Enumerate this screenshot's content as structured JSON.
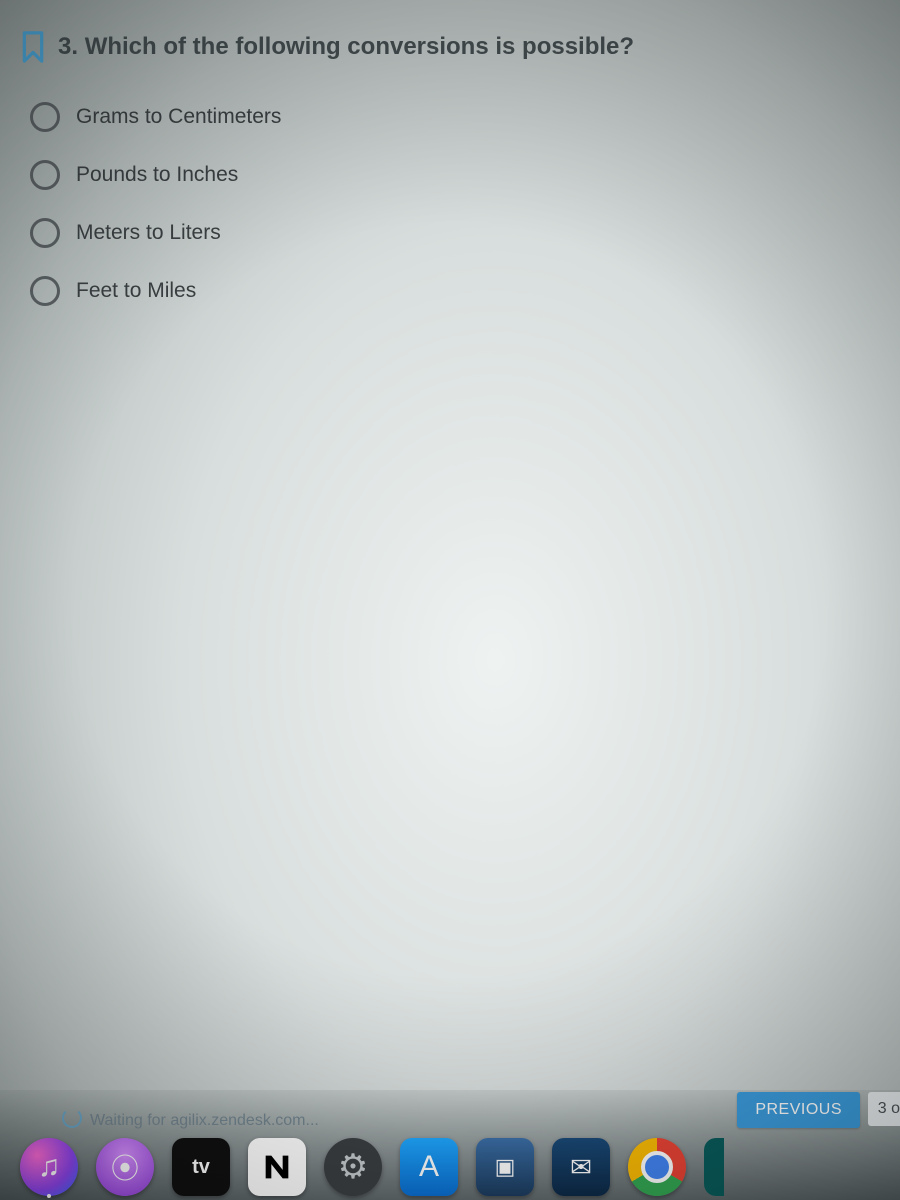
{
  "question": {
    "number": "3.",
    "text": "Which of the following conversions is possible?"
  },
  "options": [
    {
      "label": "Grams to Centimeters"
    },
    {
      "label": "Pounds to Inches"
    },
    {
      "label": "Meters to Liters"
    },
    {
      "label": "Feet to Miles"
    }
  ],
  "status": {
    "text": "Waiting for agilix.zendesk.com..."
  },
  "nav": {
    "previous": "PREVIOUS",
    "page_fragment": "3 o"
  },
  "dock": {
    "appletv": "tv"
  }
}
